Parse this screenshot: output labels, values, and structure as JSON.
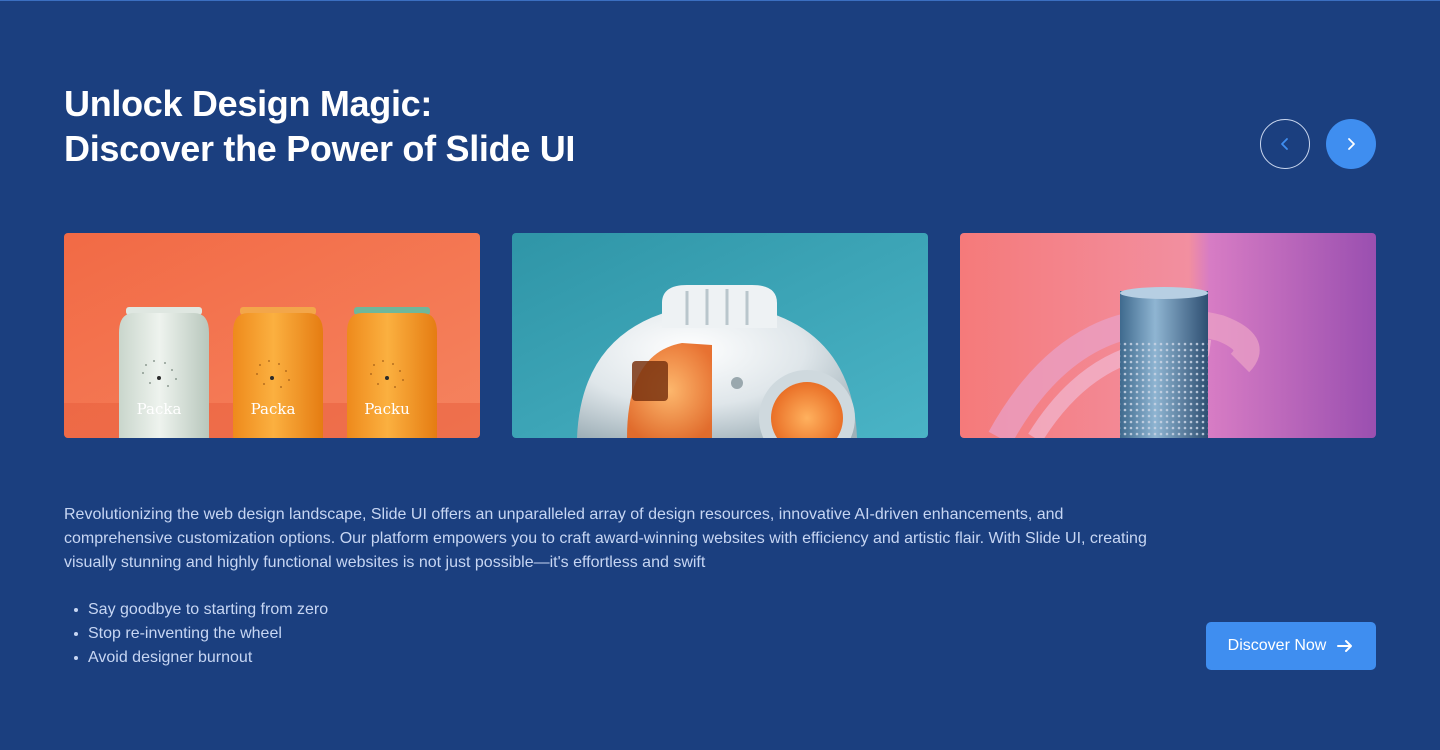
{
  "hero": {
    "title_line1": "Unlock Design Magic:",
    "title_line2": "Discover the Power of Slide UI"
  },
  "carousel": {
    "prev_icon": "chevron-left-icon",
    "next_icon": "chevron-right-icon",
    "slides": [
      {
        "image": "packaging-bottles-image",
        "labels": [
          "Packa",
          "Packa",
          "Packu"
        ]
      },
      {
        "image": "robot-helmet-image"
      },
      {
        "image": "smart-speaker-image"
      }
    ]
  },
  "content": {
    "description": "Revolutionizing the web design landscape, Slide UI offers an unparalleled array of design resources, innovative AI-driven enhancements, and comprehensive customization options. Our platform empowers you to craft award-winning websites with efficiency and artistic flair. With Slide UI, creating visually stunning and highly functional websites is not just possible—it's effortless and swift",
    "features": [
      "Say goodbye to starting from zero",
      "Stop re-inventing the wheel",
      "Avoid designer burnout"
    ]
  },
  "cta": {
    "label": "Discover Now",
    "icon": "arrow-right-icon"
  },
  "colors": {
    "background": "#1b3f7f",
    "accent": "#3f8ef0",
    "text_primary": "#ffffff",
    "text_secondary": "#c7d6f3"
  }
}
